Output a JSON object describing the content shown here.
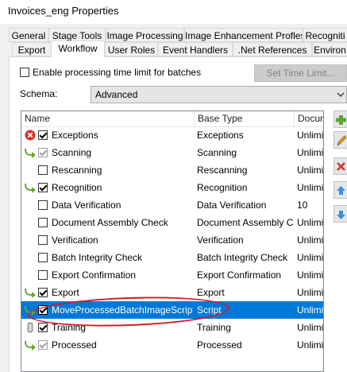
{
  "window": {
    "title": "Invoices_eng Properties"
  },
  "tabs_row1": [
    "General",
    "Stage Tools",
    "Image Processing",
    "Image Enhancement Profles",
    "Recogniti"
  ],
  "tabs_row2": [
    "Export",
    "Workflow",
    "User Roles",
    "Event Handlers",
    ".Net References",
    "Environ"
  ],
  "active_tab": "Workflow",
  "workflow": {
    "time_limit_label": "Enable processing time limit for batches",
    "time_limit_checked": false,
    "set_time_limit_label": "Set Time Limit...",
    "schema_label": "Schema:",
    "schema_value": "Advanced",
    "columns": [
      "Name",
      "Base Type",
      "Docum"
    ],
    "rows": [
      {
        "name": "Exceptions",
        "base_type": "Exceptions",
        "doc": "Unlimite",
        "checked": true,
        "enabled": true,
        "icon": "error-icon",
        "selected": false
      },
      {
        "name": "Scanning",
        "base_type": "Scanning",
        "doc": "Unlimite",
        "checked": true,
        "enabled": false,
        "icon": "stage-arrow-icon",
        "selected": false
      },
      {
        "name": "Rescanning",
        "base_type": "Rescanning",
        "doc": "Unlimite",
        "checked": false,
        "enabled": true,
        "icon": "",
        "selected": false
      },
      {
        "name": "Recognition",
        "base_type": "Recognition",
        "doc": "Unlimite",
        "checked": true,
        "enabled": true,
        "icon": "stage-arrow-icon",
        "selected": false
      },
      {
        "name": "Data Verification",
        "base_type": "Data Verification",
        "doc": "10",
        "checked": false,
        "enabled": true,
        "icon": "",
        "selected": false
      },
      {
        "name": "Document Assembly Check",
        "base_type": "Document Assembly C...",
        "doc": "Unlimite",
        "checked": false,
        "enabled": true,
        "icon": "",
        "selected": false
      },
      {
        "name": "Verification",
        "base_type": "Verification",
        "doc": "Unlimite",
        "checked": false,
        "enabled": true,
        "icon": "",
        "selected": false
      },
      {
        "name": "Batch Integrity Check",
        "base_type": "Batch Integrity Check",
        "doc": "Unlimite",
        "checked": false,
        "enabled": true,
        "icon": "",
        "selected": false
      },
      {
        "name": "Export Confirmation",
        "base_type": "Export Confirmation",
        "doc": "Unlimite",
        "checked": false,
        "enabled": true,
        "icon": "",
        "selected": false
      },
      {
        "name": "Export",
        "base_type": "Export",
        "doc": "Unlimite",
        "checked": true,
        "enabled": true,
        "icon": "stage-arrow-icon",
        "selected": false
      },
      {
        "name": "MoveProcessedBatchImageScript",
        "base_type": "Script",
        "doc": "Unlimite",
        "checked": true,
        "enabled": true,
        "icon": "stage-arrow-icon",
        "selected": true
      },
      {
        "name": "Training",
        "base_type": "Training",
        "doc": "Unlimite",
        "checked": true,
        "enabled": true,
        "icon": "training-icon",
        "selected": false
      },
      {
        "name": "Processed",
        "base_type": "Processed",
        "doc": "Unlimite",
        "checked": true,
        "enabled": false,
        "icon": "stage-arrow-icon",
        "selected": false
      }
    ]
  },
  "side_buttons": [
    "add-icon",
    "edit-icon",
    "delete-icon",
    "move-up-icon",
    "move-down-icon"
  ],
  "colors": {
    "selection": "#0078d7",
    "highlight_oval": "#d8192a",
    "arrow_green": "#6aa42f",
    "error_red": "#d9312b"
  }
}
